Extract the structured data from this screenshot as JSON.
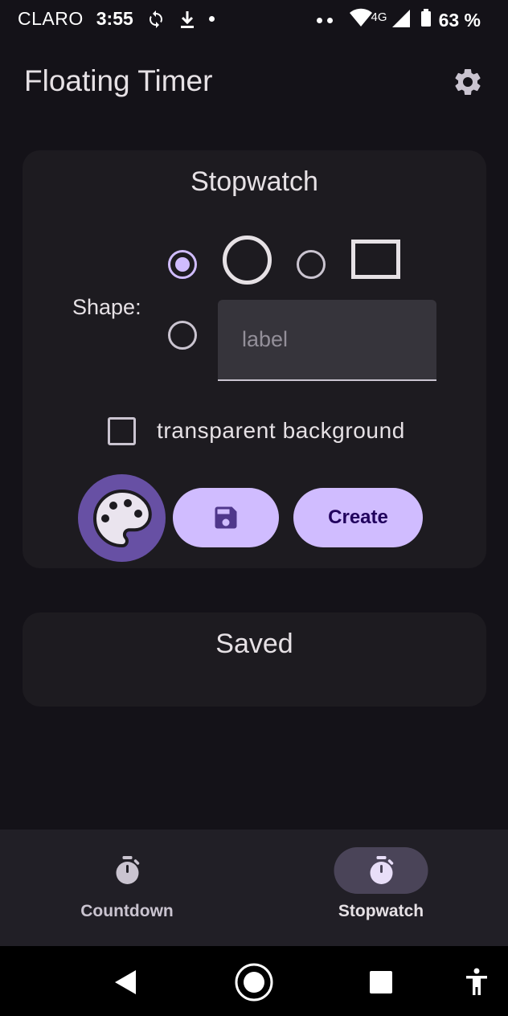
{
  "status_bar": {
    "carrier": "CLARO",
    "time": "3:55",
    "network": "4G",
    "battery": "63 %"
  },
  "app_bar": {
    "title": "Floating Timer",
    "settings_icon": "gear-icon"
  },
  "timer_card": {
    "title": "Stopwatch",
    "shape_label": "Shape:",
    "shape_options": [
      {
        "id": "circle",
        "selected": true
      },
      {
        "id": "rectangle",
        "selected": false
      },
      {
        "id": "label",
        "selected": false
      }
    ],
    "label_placeholder": "label",
    "label_value": "",
    "transparent_label": "transparent background",
    "transparent_checked": false,
    "create_label": "Create"
  },
  "saved_card": {
    "title": "Saved"
  },
  "bottom_nav": {
    "items": [
      {
        "label": "Countdown",
        "icon": "stopwatch-icon",
        "active": false
      },
      {
        "label": "Stopwatch",
        "icon": "stopwatch-icon",
        "active": true
      }
    ]
  },
  "colors": {
    "background": "#141218",
    "surface": "#1d1b20",
    "primary": "#d0bcff",
    "primary_container": "#6750a4",
    "on_primary": "#21005d"
  }
}
